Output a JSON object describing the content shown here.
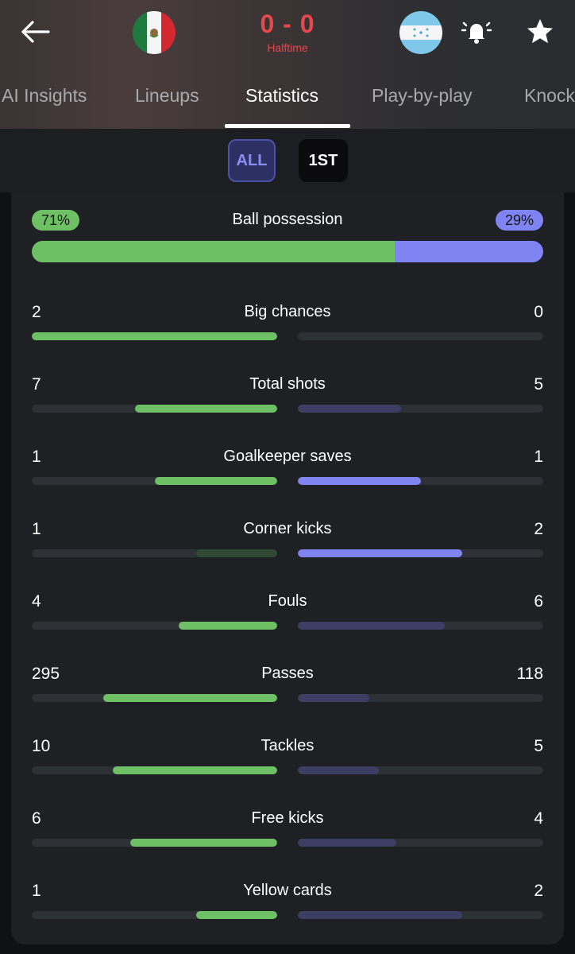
{
  "header": {
    "score": "0 - 0",
    "status": "Halftime",
    "home_flag": "mexico-flag",
    "away_flag": "honduras-flag",
    "score_color": "#e5484d"
  },
  "tabs": [
    {
      "label": "AI Insights",
      "active": false
    },
    {
      "label": "Lineups",
      "active": false
    },
    {
      "label": "Statistics",
      "active": true
    },
    {
      "label": "Play-by-play",
      "active": false
    },
    {
      "label": "Knock",
      "active": false
    }
  ],
  "period_filter": {
    "options": [
      "ALL",
      "1ST"
    ],
    "selected": "ALL"
  },
  "colors": {
    "home_fill": "#6dc063",
    "home_fill_dim": "#2f4a33",
    "away_fill": "#7f84f2",
    "away_fill_dim": "#3c3f63",
    "track": "#2d3035"
  },
  "possession": {
    "label": "Ball possession",
    "home": "71%",
    "away": "29%",
    "home_fraction": 0.71
  },
  "stats": [
    {
      "label": "Big chances",
      "home": "2",
      "away": "0",
      "home_frac": 1.0,
      "away_frac": 0.0,
      "home_style": "bright",
      "away_style": "dim"
    },
    {
      "label": "Total shots",
      "home": "7",
      "away": "5",
      "home_frac": 0.58,
      "away_frac": 0.42,
      "home_style": "bright",
      "away_style": "dim"
    },
    {
      "label": "Goalkeeper saves",
      "home": "1",
      "away": "1",
      "home_frac": 0.5,
      "away_frac": 0.5,
      "home_style": "bright",
      "away_style": "bright"
    },
    {
      "label": "Corner kicks",
      "home": "1",
      "away": "2",
      "home_frac": 0.33,
      "away_frac": 0.67,
      "home_style": "dim",
      "away_style": "bright"
    },
    {
      "label": "Fouls",
      "home": "4",
      "away": "6",
      "home_frac": 0.4,
      "away_frac": 0.6,
      "home_style": "bright",
      "away_style": "dim"
    },
    {
      "label": "Passes",
      "home": "295",
      "away": "118",
      "home_frac": 0.71,
      "away_frac": 0.29,
      "home_style": "bright",
      "away_style": "dim"
    },
    {
      "label": "Tackles",
      "home": "10",
      "away": "5",
      "home_frac": 0.67,
      "away_frac": 0.33,
      "home_style": "bright",
      "away_style": "dim"
    },
    {
      "label": "Free kicks",
      "home": "6",
      "away": "4",
      "home_frac": 0.6,
      "away_frac": 0.4,
      "home_style": "bright",
      "away_style": "dim"
    },
    {
      "label": "Yellow cards",
      "home": "1",
      "away": "2",
      "home_frac": 0.33,
      "away_frac": 0.67,
      "home_style": "bright",
      "away_style": "dim"
    }
  ]
}
